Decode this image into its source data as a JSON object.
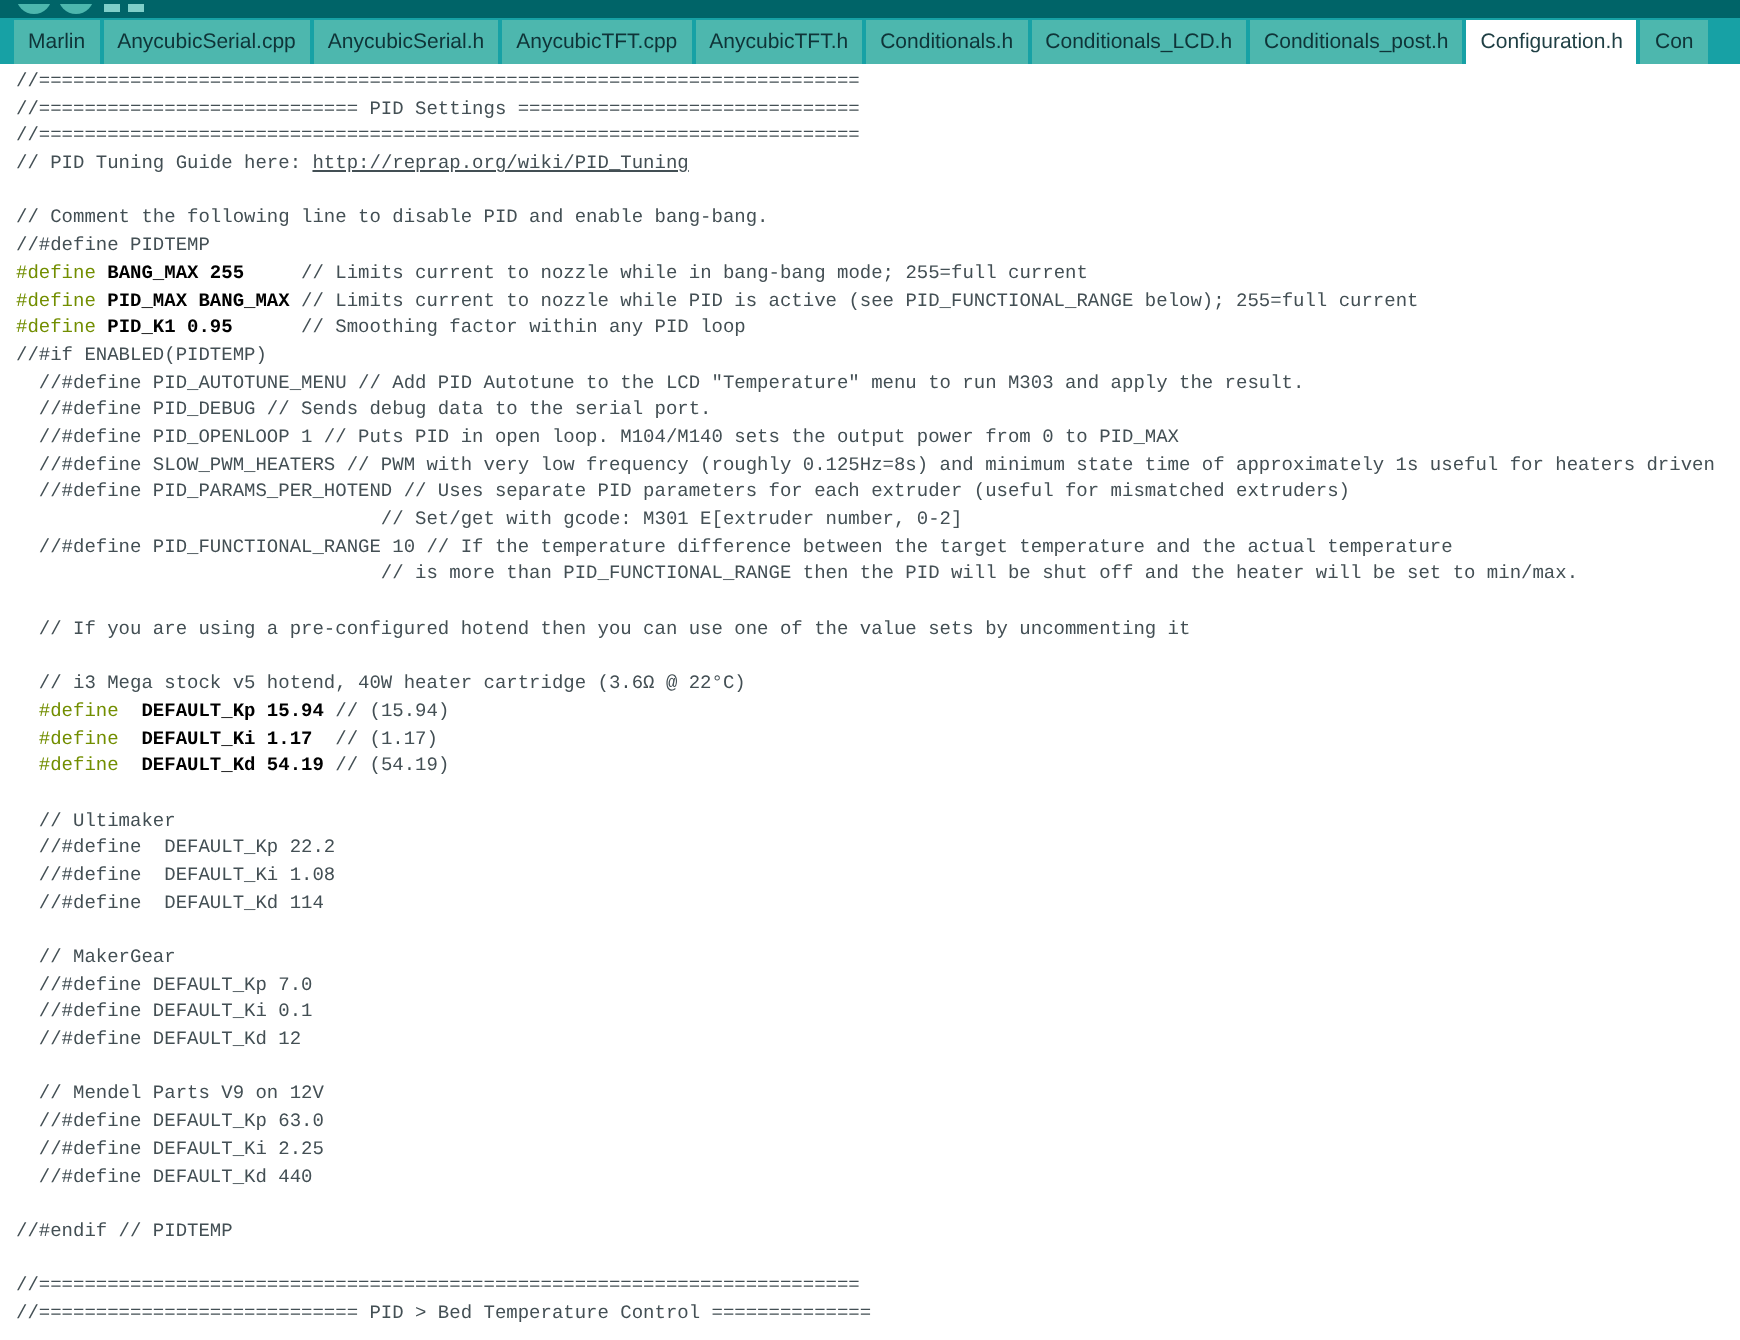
{
  "tabs": [
    {
      "label": "Marlin",
      "selected": false
    },
    {
      "label": "AnycubicSerial.cpp",
      "selected": false
    },
    {
      "label": "AnycubicSerial.h",
      "selected": false
    },
    {
      "label": "AnycubicTFT.cpp",
      "selected": false
    },
    {
      "label": "AnycubicTFT.h",
      "selected": false
    },
    {
      "label": "Conditionals.h",
      "selected": false
    },
    {
      "label": "Conditionals_LCD.h",
      "selected": false
    },
    {
      "label": "Conditionals_post.h",
      "selected": false
    },
    {
      "label": "Configuration.h",
      "selected": true
    },
    {
      "label": "Con",
      "selected": false
    }
  ],
  "lines": [
    {
      "kind": "code",
      "tokens": [
        {
          "kind": "comment",
          "text": "//========================================================================"
        }
      ]
    },
    {
      "kind": "code",
      "tokens": [
        {
          "kind": "comment",
          "text": "//============================ PID Settings =============================="
        }
      ]
    },
    {
      "kind": "code",
      "tokens": [
        {
          "kind": "comment",
          "text": "//========================================================================"
        }
      ]
    },
    {
      "kind": "code",
      "tokens": [
        {
          "kind": "comment",
          "text": "// PID Tuning Guide here: "
        },
        {
          "kind": "link",
          "text": "http://reprap.org/wiki/PID_Tuning"
        }
      ]
    },
    {
      "kind": "blank"
    },
    {
      "kind": "code",
      "tokens": [
        {
          "kind": "comment",
          "text": "// Comment the following line to disable PID and enable bang-bang."
        }
      ]
    },
    {
      "kind": "code",
      "tokens": [
        {
          "kind": "comment",
          "text": "//#define PIDTEMP"
        }
      ]
    },
    {
      "kind": "code",
      "tokens": [
        {
          "kind": "keyword",
          "text": "#define"
        },
        {
          "kind": "ident",
          "text": " BANG_MAX 255"
        },
        {
          "kind": "comment",
          "text": "     // Limits current to nozzle while in bang-bang mode; 255=full current"
        }
      ]
    },
    {
      "kind": "code",
      "tokens": [
        {
          "kind": "keyword",
          "text": "#define"
        },
        {
          "kind": "ident",
          "text": " PID_MAX BANG_MAX"
        },
        {
          "kind": "comment",
          "text": " // Limits current to nozzle while PID is active (see PID_FUNCTIONAL_RANGE below); 255=full current"
        }
      ]
    },
    {
      "kind": "code",
      "tokens": [
        {
          "kind": "keyword",
          "text": "#define"
        },
        {
          "kind": "ident",
          "text": " PID_K1 0.95"
        },
        {
          "kind": "comment",
          "text": "      // Smoothing factor within any PID loop"
        }
      ]
    },
    {
      "kind": "code",
      "tokens": [
        {
          "kind": "comment",
          "text": "//#if ENABLED(PIDTEMP)"
        }
      ]
    },
    {
      "kind": "code",
      "tokens": [
        {
          "kind": "comment",
          "text": "  //#define PID_AUTOTUNE_MENU // Add PID Autotune to the LCD \"Temperature\" menu to run M303 and apply the result."
        }
      ]
    },
    {
      "kind": "code",
      "tokens": [
        {
          "kind": "comment",
          "text": "  //#define PID_DEBUG // Sends debug data to the serial port."
        }
      ]
    },
    {
      "kind": "code",
      "tokens": [
        {
          "kind": "comment",
          "text": "  //#define PID_OPENLOOP 1 // Puts PID in open loop. M104/M140 sets the output power from 0 to PID_MAX"
        }
      ]
    },
    {
      "kind": "code",
      "tokens": [
        {
          "kind": "comment",
          "text": "  //#define SLOW_PWM_HEATERS // PWM with very low frequency (roughly 0.125Hz=8s) and minimum state time of approximately 1s useful for heaters driven"
        }
      ]
    },
    {
      "kind": "code",
      "tokens": [
        {
          "kind": "comment",
          "text": "  //#define PID_PARAMS_PER_HOTEND // Uses separate PID parameters for each extruder (useful for mismatched extruders)"
        }
      ]
    },
    {
      "kind": "code",
      "tokens": [
        {
          "kind": "comment",
          "text": "                                // Set/get with gcode: M301 E[extruder number, 0-2]"
        }
      ]
    },
    {
      "kind": "code",
      "tokens": [
        {
          "kind": "comment",
          "text": "  //#define PID_FUNCTIONAL_RANGE 10 // If the temperature difference between the target temperature and the actual temperature"
        }
      ]
    },
    {
      "kind": "code",
      "tokens": [
        {
          "kind": "comment",
          "text": "                                // is more than PID_FUNCTIONAL_RANGE then the PID will be shut off and the heater will be set to min/max."
        }
      ]
    },
    {
      "kind": "blank"
    },
    {
      "kind": "code",
      "tokens": [
        {
          "kind": "comment",
          "text": "  // If you are using a pre-configured hotend then you can use one of the value sets by uncommenting it"
        }
      ]
    },
    {
      "kind": "blank"
    },
    {
      "kind": "code",
      "tokens": [
        {
          "kind": "comment",
          "text": "  // i3 Mega stock v5 hotend, 40W heater cartridge (3.6Ω @ 22°C)"
        }
      ]
    },
    {
      "kind": "code",
      "tokens": [
        {
          "kind": "keyword",
          "text": "  #define"
        },
        {
          "kind": "ident",
          "text": "  DEFAULT_Kp 15.94"
        },
        {
          "kind": "comment",
          "text": " // (15.94)"
        }
      ]
    },
    {
      "kind": "code",
      "tokens": [
        {
          "kind": "keyword",
          "text": "  #define"
        },
        {
          "kind": "ident",
          "text": "  DEFAULT_Ki 1.17"
        },
        {
          "kind": "comment",
          "text": "  // (1.17)"
        }
      ]
    },
    {
      "kind": "code",
      "tokens": [
        {
          "kind": "keyword",
          "text": "  #define"
        },
        {
          "kind": "ident",
          "text": "  DEFAULT_Kd 54.19"
        },
        {
          "kind": "comment",
          "text": " // (54.19)"
        }
      ]
    },
    {
      "kind": "blank"
    },
    {
      "kind": "code",
      "tokens": [
        {
          "kind": "comment",
          "text": "  // Ultimaker"
        }
      ]
    },
    {
      "kind": "code",
      "tokens": [
        {
          "kind": "comment",
          "text": "  //#define  DEFAULT_Kp 22.2"
        }
      ]
    },
    {
      "kind": "code",
      "tokens": [
        {
          "kind": "comment",
          "text": "  //#define  DEFAULT_Ki 1.08"
        }
      ]
    },
    {
      "kind": "code",
      "tokens": [
        {
          "kind": "comment",
          "text": "  //#define  DEFAULT_Kd 114"
        }
      ]
    },
    {
      "kind": "blank"
    },
    {
      "kind": "code",
      "tokens": [
        {
          "kind": "comment",
          "text": "  // MakerGear"
        }
      ]
    },
    {
      "kind": "code",
      "tokens": [
        {
          "kind": "comment",
          "text": "  //#define DEFAULT_Kp 7.0"
        }
      ]
    },
    {
      "kind": "code",
      "tokens": [
        {
          "kind": "comment",
          "text": "  //#define DEFAULT_Ki 0.1"
        }
      ]
    },
    {
      "kind": "code",
      "tokens": [
        {
          "kind": "comment",
          "text": "  //#define DEFAULT_Kd 12"
        }
      ]
    },
    {
      "kind": "blank"
    },
    {
      "kind": "code",
      "tokens": [
        {
          "kind": "comment",
          "text": "  // Mendel Parts V9 on 12V"
        }
      ]
    },
    {
      "kind": "code",
      "tokens": [
        {
          "kind": "comment",
          "text": "  //#define DEFAULT_Kp 63.0"
        }
      ]
    },
    {
      "kind": "code",
      "tokens": [
        {
          "kind": "comment",
          "text": "  //#define DEFAULT_Ki 2.25"
        }
      ]
    },
    {
      "kind": "code",
      "tokens": [
        {
          "kind": "comment",
          "text": "  //#define DEFAULT_Kd 440"
        }
      ]
    },
    {
      "kind": "blank"
    },
    {
      "kind": "code",
      "tokens": [
        {
          "kind": "comment",
          "text": "//#endif // PIDTEMP"
        }
      ]
    },
    {
      "kind": "blank"
    },
    {
      "kind": "code",
      "tokens": [
        {
          "kind": "comment",
          "text": "//========================================================================"
        }
      ]
    },
    {
      "kind": "code",
      "tokens": [
        {
          "kind": "comment",
          "text": "//============================ PID > Bed Temperature Control =============="
        }
      ]
    }
  ]
}
